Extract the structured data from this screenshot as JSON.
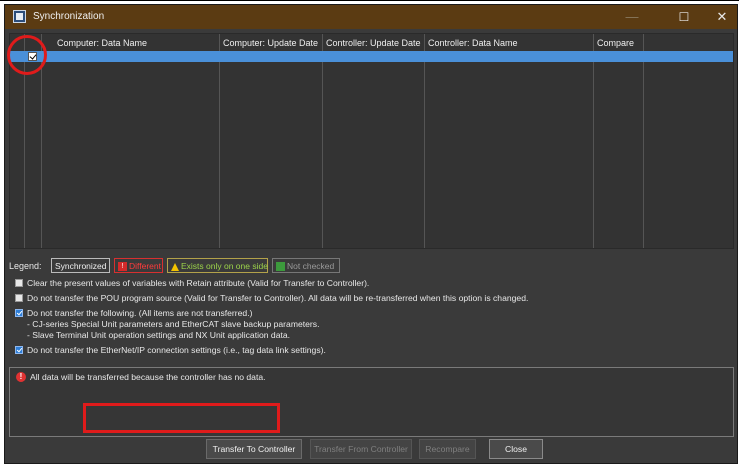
{
  "window": {
    "title": "Synchronization",
    "controls": {
      "minimize": "—",
      "maximize": "☐",
      "close": "✕"
    }
  },
  "table": {
    "columns": [
      "Computer: Data Name",
      "Computer: Update Date",
      "Controller: Update Date",
      "Controller: Data Name",
      "Compare"
    ],
    "rows": [
      {
        "checked": true,
        "computer_data_name": "",
        "computer_update_date": "",
        "controller_update_date": "",
        "controller_data_name": "",
        "compare": ""
      }
    ]
  },
  "legend": {
    "label": "Legend:",
    "synchronized": "Synchronized",
    "different": "Different",
    "exists_one_side": "Exists only on one side",
    "not_checked": "Not checked"
  },
  "options": [
    {
      "checked": false,
      "text": "Clear the present values of variables with Retain attribute (Valid for Transfer to Controller)."
    },
    {
      "checked": false,
      "text": "Do not transfer the POU program source (Valid for Transfer to Controller). All data will be re-transferred when this option is changed."
    },
    {
      "checked": true,
      "text": "Do not transfer the following. (All items are not transferred.)",
      "subitems": [
        "- CJ-series Special Unit parameters and EtherCAT slave backup parameters.",
        "- Slave Terminal Unit operation settings and NX Unit application data."
      ]
    },
    {
      "checked": true,
      "text": "Do not transfer the EtherNet/IP connection settings (i.e., tag data link settings)."
    }
  ],
  "message": {
    "icon": "error-icon",
    "text": "All data will be transferred because the controller has no data."
  },
  "buttons": {
    "transfer_to_controller": "Transfer To Controller",
    "transfer_from_controller": "Transfer From Controller",
    "recompare": "Recompare",
    "close": "Close"
  },
  "colors": {
    "title_bar": "#5b3b12",
    "selected_row": "#4a90d9",
    "annotation_red": "#e01b1b"
  }
}
